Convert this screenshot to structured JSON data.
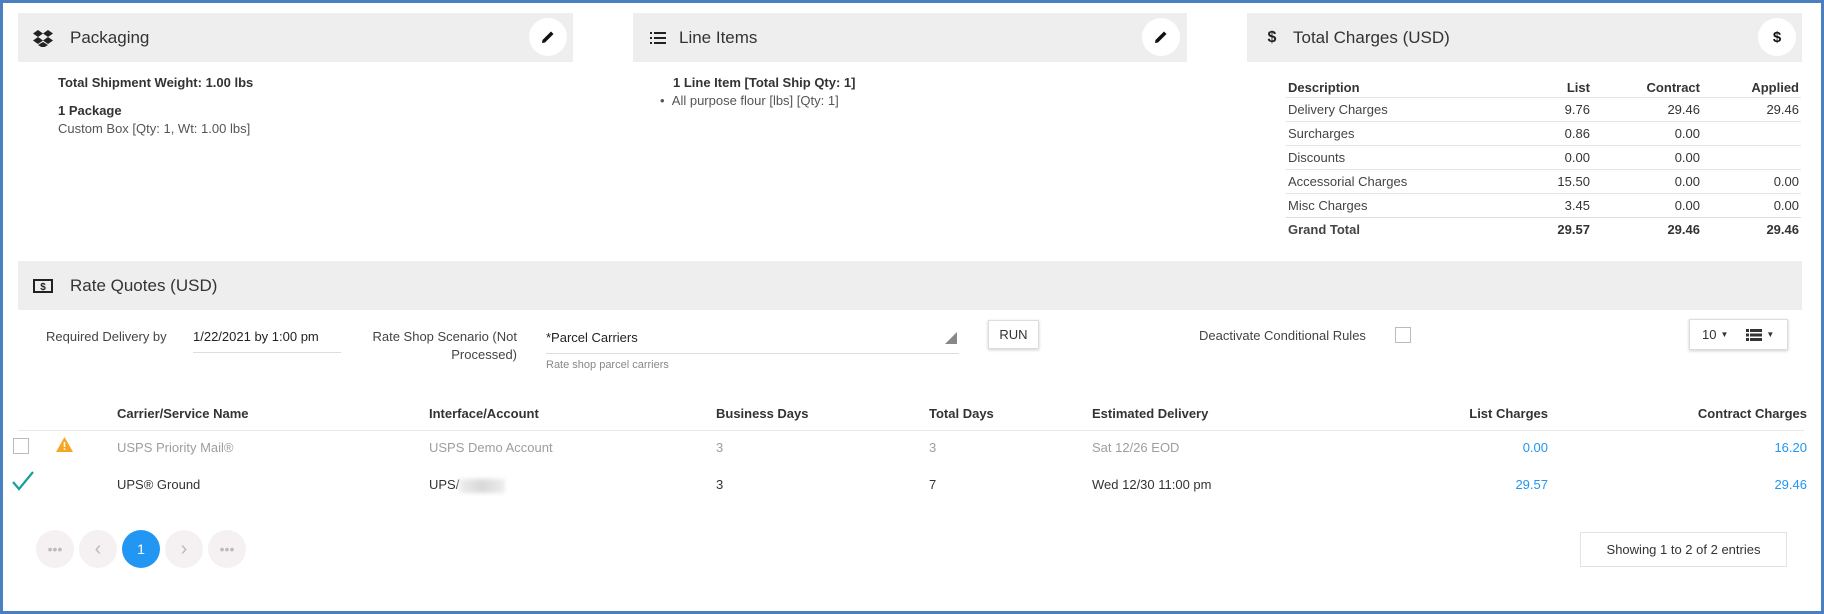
{
  "packaging": {
    "title": "Packaging",
    "total_weight": "Total Shipment Weight: 1.00 lbs",
    "package_count": "1 Package",
    "package_detail": "Custom Box [Qty: 1, Wt: 1.00 lbs]"
  },
  "line_items": {
    "title": "Line Items",
    "summary": "1 Line Item [Total Ship Qty: 1]",
    "items": [
      "All purpose flour [lbs] [Qty: 1]"
    ]
  },
  "total_charges": {
    "title": "Total Charges (USD)",
    "button_label": "$",
    "headers": [
      "Description",
      "List",
      "Contract",
      "Applied"
    ],
    "rows": [
      {
        "desc": "Delivery Charges",
        "list": "9.76",
        "contract": "29.46",
        "applied": "29.46"
      },
      {
        "desc": "Surcharges",
        "list": "0.86",
        "contract": "0.00",
        "applied": ""
      },
      {
        "desc": "Discounts",
        "list": "0.00",
        "contract": "0.00",
        "applied": ""
      },
      {
        "desc": "Accessorial Charges",
        "list": "15.50",
        "contract": "0.00",
        "applied": "0.00"
      },
      {
        "desc": "Misc Charges",
        "list": "3.45",
        "contract": "0.00",
        "applied": "0.00"
      }
    ],
    "grand_total": {
      "desc": "Grand Total",
      "list": "29.57",
      "contract": "29.46",
      "applied": "29.46"
    }
  },
  "rate_quotes": {
    "title": "Rate Quotes (USD)",
    "required_delivery_label": "Required Delivery by",
    "required_delivery_value": "1/22/2021 by 1:00 pm",
    "scenario_label": "Rate Shop Scenario (Not Processed)",
    "scenario_value": "*Parcel Carriers",
    "scenario_hint": "Rate shop parcel carriers",
    "run_label": "RUN",
    "deactivate_label": "Deactivate Conditional Rules",
    "page_size": "10",
    "columns": [
      "Carrier/Service Name",
      "Interface/Account",
      "Business Days",
      "Total Days",
      "Estimated Delivery",
      "List Charges",
      "Contract Charges"
    ],
    "rows": [
      {
        "carrier": "USPS Priority Mail®",
        "account": "USPS Demo Account",
        "business_days": "3",
        "total_days": "3",
        "delivery": "Sat 12/26 EOD",
        "list": "0.00",
        "contract": "16.20"
      },
      {
        "carrier": "UPS® Ground",
        "account": "UPS/",
        "business_days": "3",
        "total_days": "7",
        "delivery": "Wed 12/30 11:00 pm",
        "list": "29.57",
        "contract": "29.46"
      }
    ],
    "pagination": {
      "first": "•••",
      "prev": "‹",
      "current": "1",
      "next": "›",
      "last": "•••"
    },
    "showing": "Showing 1 to 2 of 2 entries"
  },
  "colors": {
    "accent": "#2196f3",
    "warning": "#f5a623",
    "check": "#1a9e96",
    "frame": "#4a7fc1"
  }
}
